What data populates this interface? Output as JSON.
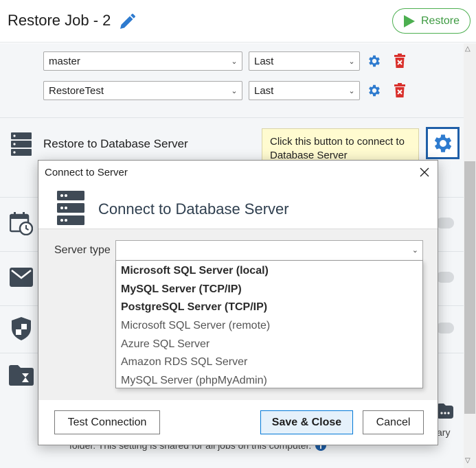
{
  "header": {
    "title": "Restore Job - 2",
    "restore_button": "Restore"
  },
  "databases": [
    {
      "name": "master",
      "backup": "Last"
    },
    {
      "name": "RestoreTest",
      "backup": "Last"
    }
  ],
  "restore_section": {
    "label": "Restore to Database Server",
    "tooltip": "Click this button to connect to Database Server"
  },
  "footer": {
    "text": "folder. This setting is shared for all jobs on this computer.",
    "partial_right": "ary"
  },
  "dialog": {
    "title": "Connect to Server",
    "heading": "Connect to Database Server",
    "server_type_label": "Server type",
    "server_type_value": "",
    "options": [
      {
        "label": "Microsoft SQL Server (local)",
        "bold": true
      },
      {
        "label": "MySQL Server (TCP/IP)",
        "bold": true
      },
      {
        "label": "PostgreSQL Server (TCP/IP)",
        "bold": true
      },
      {
        "label": "Microsoft SQL Server (remote)",
        "bold": false
      },
      {
        "label": "Azure SQL Server",
        "bold": false
      },
      {
        "label": "Amazon RDS SQL Server",
        "bold": false
      },
      {
        "label": "MySQL Server (phpMyAdmin)",
        "bold": false
      }
    ],
    "buttons": {
      "test": "Test Connection",
      "save": "Save & Close",
      "cancel": "Cancel"
    }
  },
  "colors": {
    "accent_blue": "#2e7bcf",
    "delete_red": "#d9302c",
    "restore_green": "#4caf50",
    "icon_dark": "#3f4a56"
  }
}
